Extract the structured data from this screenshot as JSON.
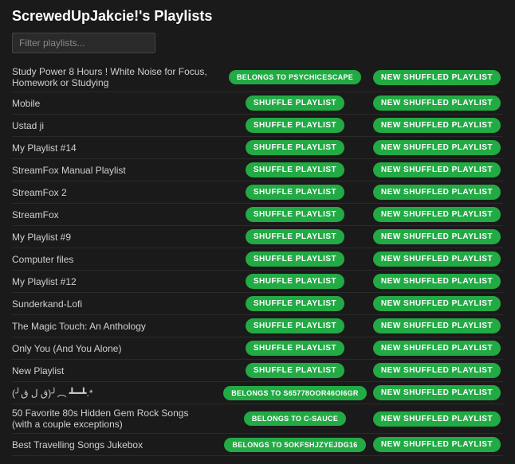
{
  "title": "ScrewedUpJakcie!'s Playlists",
  "search": {
    "placeholder": "Filter playlists..."
  },
  "buttons": {
    "shuffle": "SHUFFLE PLAYLIST",
    "new_shuffled": "NEW SHUFFLED PLAYLIST"
  },
  "playlists": [
    {
      "name": "Study Power 8 Hours ! White Noise for Focus, Homework or Studying",
      "action1_type": "belongs",
      "action1_label": "BELONGS TO PSYCHICESCAPE",
      "action2_label": "NEW SHUFFLED PLAYLIST"
    },
    {
      "name": "Mobile",
      "action1_type": "shuffle",
      "action1_label": "SHUFFLE PLAYLIST",
      "action2_label": "NEW SHUFFLED PLAYLIST"
    },
    {
      "name": "Ustad ji",
      "action1_type": "shuffle",
      "action1_label": "SHUFFLE PLAYLIST",
      "action2_label": "NEW SHUFFLED PLAYLIST"
    },
    {
      "name": "My Playlist #14",
      "action1_type": "shuffle",
      "action1_label": "SHUFFLE PLAYLIST",
      "action2_label": "NEW SHUFFLED PLAYLIST"
    },
    {
      "name": "StreamFox Manual Playlist",
      "action1_type": "shuffle",
      "action1_label": "SHUFFLE PLAYLIST",
      "action2_label": "NEW SHUFFLED PLAYLIST"
    },
    {
      "name": "StreamFox 2",
      "action1_type": "shuffle",
      "action1_label": "SHUFFLE PLAYLIST",
      "action2_label": "NEW SHUFFLED PLAYLIST"
    },
    {
      "name": "StreamFox",
      "action1_type": "shuffle",
      "action1_label": "SHUFFLE PLAYLIST",
      "action2_label": "NEW SHUFFLED PLAYLIST"
    },
    {
      "name": "My Playlist #9",
      "action1_type": "shuffle",
      "action1_label": "SHUFFLE PLAYLIST",
      "action2_label": "NEW SHUFFLED PLAYLIST"
    },
    {
      "name": "Computer files",
      "action1_type": "shuffle",
      "action1_label": "SHUFFLE PLAYLIST",
      "action2_label": "NEW SHUFFLED PLAYLIST"
    },
    {
      "name": "My Playlist #12",
      "action1_type": "shuffle",
      "action1_label": "SHUFFLE PLAYLIST",
      "action2_label": "NEW SHUFFLED PLAYLIST"
    },
    {
      "name": "Sunderkand-Lofi",
      "action1_type": "shuffle",
      "action1_label": "SHUFFLE PLAYLIST",
      "action2_label": "NEW SHUFFLED PLAYLIST"
    },
    {
      "name": "The Magic Touch: An Anthology",
      "action1_type": "shuffle",
      "action1_label": "SHUFFLE PLAYLIST",
      "action2_label": "NEW SHUFFLED PLAYLIST"
    },
    {
      "name": "Only You (And You Alone)",
      "action1_type": "shuffle",
      "action1_label": "SHUFFLE PLAYLIST",
      "action2_label": "NEW SHUFFLED PLAYLIST"
    },
    {
      "name": "New Playlist",
      "action1_type": "shuffle",
      "action1_label": "SHUFFLE PLAYLIST",
      "action2_label": "NEW SHUFFLED PLAYLIST"
    },
    {
      "name": "(╯ق ل ق)╯︵ ┻━┻.*",
      "action1_type": "belongs",
      "action1_label": "BELONGS TO S65778OOR46OI6GR",
      "action2_label": "NEW SHUFFLED PLAYLIST"
    },
    {
      "name": "50 Favorite 80s Hidden Gem Rock Songs (with a couple exceptions)",
      "action1_type": "belongs",
      "action1_label": "BELONGS TO C-SAUCE",
      "action2_label": "NEW SHUFFLED PLAYLIST"
    },
    {
      "name": "Best Travelling Songs Jukebox",
      "action1_type": "belongs",
      "action1_label": "BELONGS TO 5OKFSHJZYEJDG16",
      "action2_label": "NEW SHUFFLED PLAYLIST"
    }
  ]
}
